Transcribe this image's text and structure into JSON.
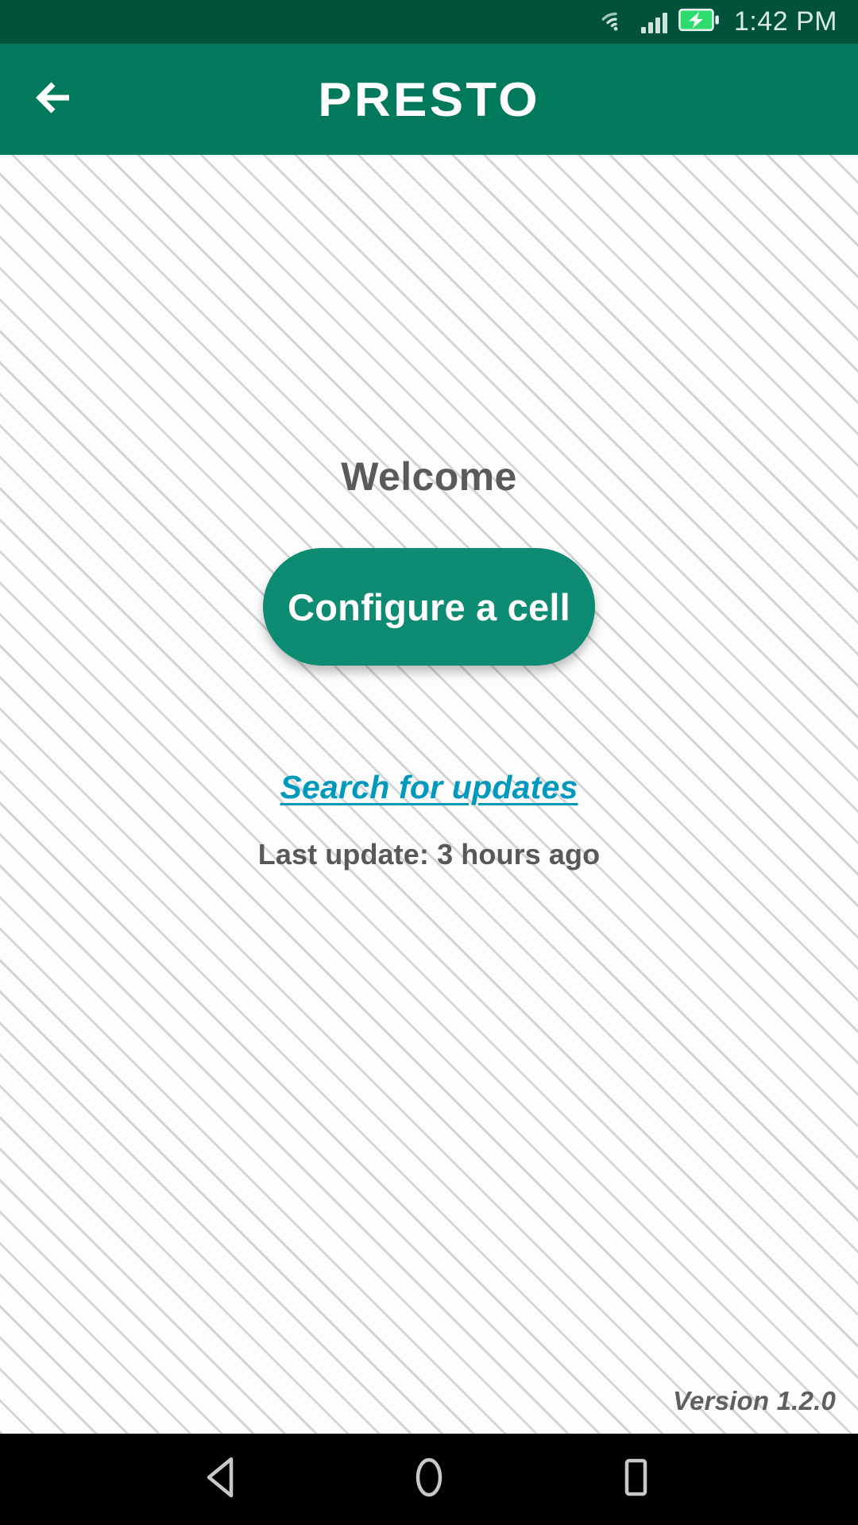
{
  "status_bar": {
    "time": "1:42 PM",
    "icons": [
      "wifi-icon",
      "signal-icon",
      "battery-charging-icon"
    ],
    "background_color": "#00513c",
    "text_color": "#d9e8e3"
  },
  "app_bar": {
    "back_label": "Back",
    "title": "PRESTO",
    "background_color": "#00795c",
    "title_color": "#ffffff"
  },
  "main": {
    "welcome_heading": "Welcome",
    "primary_button_label": "Configure a cell",
    "primary_button_color": "#0e8b73",
    "update_link_label": "Search for updates",
    "update_link_color": "#0099be",
    "last_update_text": "Last update: 3 hours ago",
    "version_text": "Version 1.2.0"
  },
  "nav_bar": {
    "background_color": "#000000",
    "icon_color": "#c8c8c8",
    "buttons": [
      {
        "name": "back",
        "label": "Back"
      },
      {
        "name": "home",
        "label": "Home"
      },
      {
        "name": "recents",
        "label": "Recents"
      }
    ]
  }
}
